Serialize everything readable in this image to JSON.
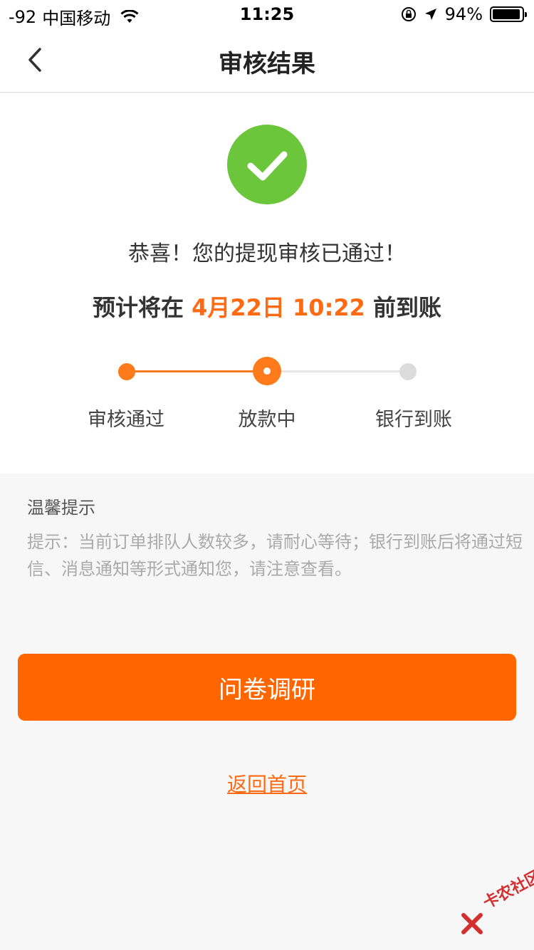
{
  "status_bar": {
    "signal": "-92",
    "carrier": "中国移动",
    "time": "11:25",
    "battery": "94%",
    "battery_level": 0.94
  },
  "nav": {
    "title": "审核结果"
  },
  "result": {
    "congrats": "恭喜！您的提现审核已通过！",
    "eta_prefix": "预计将在 ",
    "eta_date": "4月22日 10:22",
    "eta_suffix": " 前到账"
  },
  "steps": [
    {
      "label": "审核通过"
    },
    {
      "label": "放款中"
    },
    {
      "label": "银行到账"
    }
  ],
  "tips": {
    "title": "温馨提示",
    "text": "提示：当前订单排队人数较多，请耐心等待；银行到账后将通过短信、消息通知等形式通知您，请注意查看。"
  },
  "actions": {
    "survey_label": "问卷调研",
    "home_label": "返回首页"
  },
  "watermark": {
    "text": "卡农社区"
  },
  "colors": {
    "accent": "#ff6600",
    "success": "#6cc63c",
    "inactive": "#dcdcdc"
  }
}
